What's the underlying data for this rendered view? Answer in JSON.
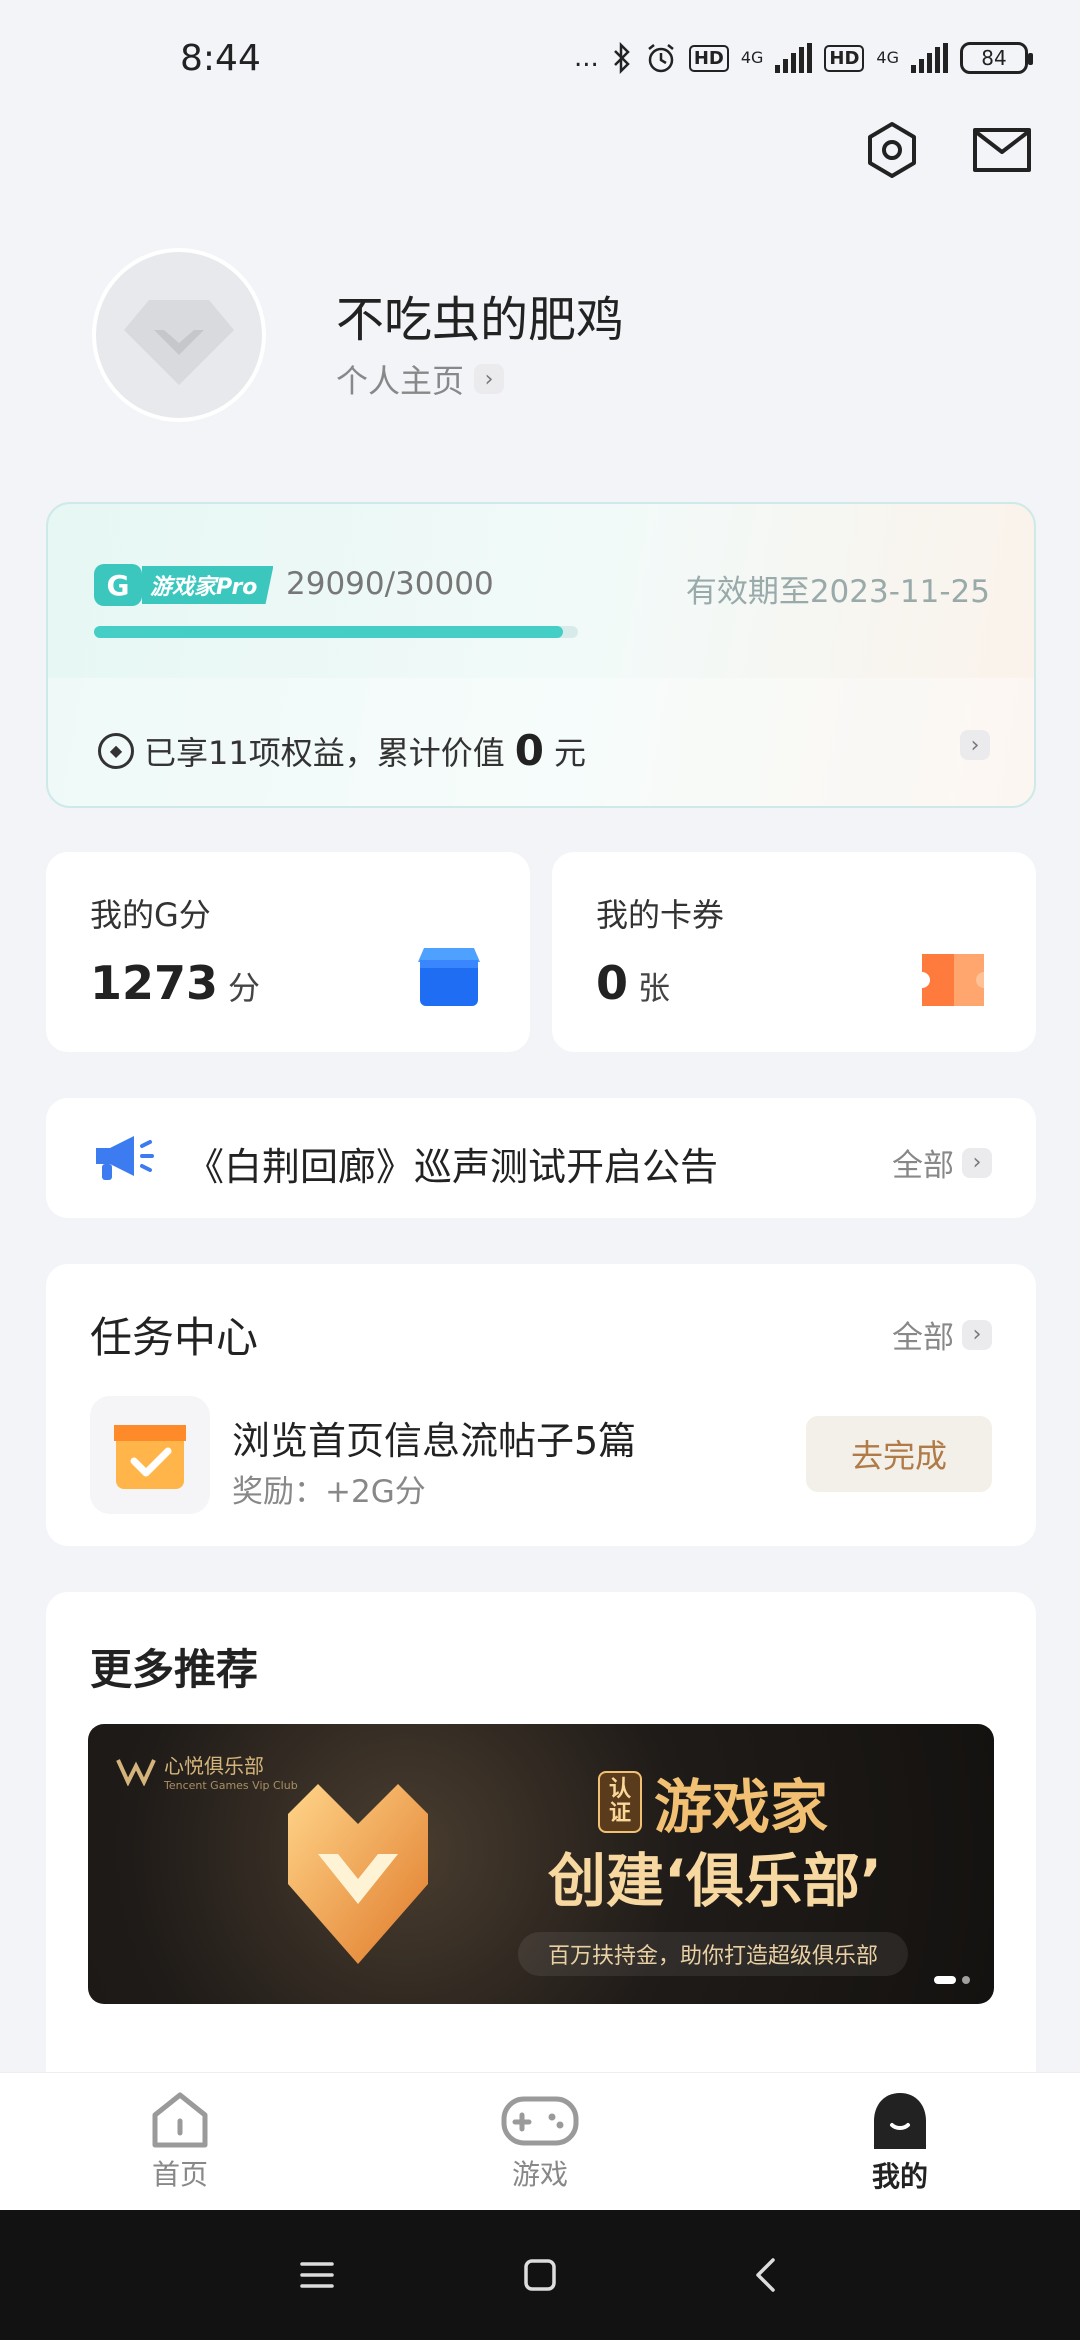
{
  "status_bar": {
    "time": "8:44",
    "dots": "...",
    "network1": "4G",
    "network2": "4G",
    "hd": "HD",
    "battery": "84"
  },
  "profile": {
    "username": "不吃虫的肥鸡",
    "homepage_link": "个人主页"
  },
  "pro_card": {
    "logo_letter": "G",
    "badge": "游戏家Pro",
    "score": "29090/30000",
    "progress_fraction": 0.97,
    "expire": "有效期至2023-11-25",
    "benefits_prefix": "已享11项权益，累计价值",
    "benefits_value": "0",
    "benefits_unit": "元"
  },
  "gpoints": {
    "label": "我的G分",
    "value": "1273",
    "unit": "分"
  },
  "coupons": {
    "label": "我的卡券",
    "value": "0",
    "unit": "张"
  },
  "announcement": {
    "text": "《白荆回廊》巡声测试开启公告",
    "all": "全部"
  },
  "task_center": {
    "title": "任务中心",
    "all": "全部",
    "task_name": "浏览首页信息流帖子5篇",
    "task_reward": "奖励：+2G分",
    "button": "去完成"
  },
  "more": {
    "title": "更多推荐",
    "banner": {
      "club_name": "心悦俱乐部",
      "club_sub": "Tencent Games Vip Club",
      "certified": "认证",
      "title1": "游戏家",
      "title2": "创建‘俱乐部’",
      "subtitle": "百万扶持金，助你打造超级俱乐部"
    }
  },
  "bottom_nav": {
    "home": "首页",
    "games": "游戏",
    "mine": "我的"
  },
  "colors": {
    "accent_teal": "#45cec6",
    "button_text": "#b07b46",
    "announce_blue": "#3d7cf0"
  }
}
